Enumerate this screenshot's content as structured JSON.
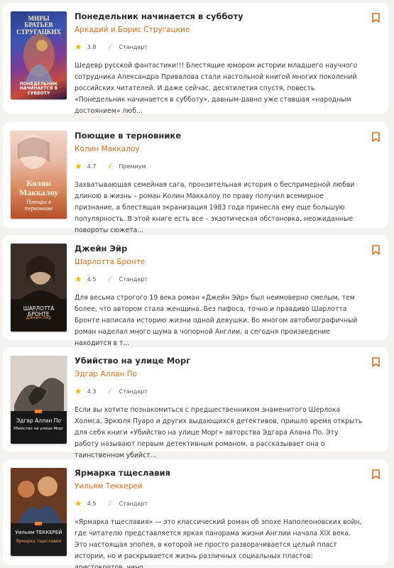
{
  "colors": {
    "accent": "#e06b17",
    "star": "#f2b705",
    "premium_icon": "#f2b705",
    "standard_icon": "#c7c7c7",
    "background": "#f4f2ef"
  },
  "books": [
    {
      "title": "Понедельник начинается в субботу",
      "author": "Аркадий и Борис Стругацкие",
      "rating": "3.8",
      "tier": "Стандарт",
      "description": "Шедевр русской фантастики!!! Блестящие юмором истории младшего научного сотрудника Александра Привалова стали настольной книгой многих поколений российских читателей. И даже сейчас, десятилетия спустя, повесть «Понедельник начинается в субботу», давным-давно уже ставшая «народным достоянием» люб...",
      "cover_top": "МИРЫ БРАТЬЕВ СТРУГАЦКИХ",
      "cover_bottom": "ПОНЕДЕЛЬНИК НАЧИНАЕТСЯ В СУББОТУ"
    },
    {
      "title": "Поющие в терновнике",
      "author": "Колин Маккалоу",
      "rating": "4.7",
      "tier": "Премиум",
      "description": "Захватывающая семейная сага, пронзительная история о беспримерной любви длиною в жизнь – роман Колин Маккалоу по праву получил всемирное признание, а блестящая экранизация 1983 года принесла ему еще большую популярность. В этой книге есть все – экзотическая обстановка, неожиданные повороты сюжета...",
      "cover_top": "Колин Маккалоу",
      "cover_bottom": "Поющие в терновнике"
    },
    {
      "title": "Джейн Эйр",
      "author": "Шарлотта Бронте",
      "rating": "4.5",
      "tier": "Стандарт",
      "description": "Для весьма строгого 19 века роман «Джейн Эйр» был неимоверно смелым, тем более, что автором стала женщина. Без пафоса, точно и правдиво Шарлотта Бронте написала историю жизни одной девушки. Во многом автобиографичный роман наделал много шума в чопорной Англии, а сегодня произведение находится в т...",
      "cover_top": "ШАРЛОТТА БРОНТЕ",
      "cover_bottom": "Джейн Эйр"
    },
    {
      "title": "Убийство на улице Морг",
      "author": "Эдгар Аллан По",
      "rating": "4.3",
      "tier": "Стандарт",
      "description": "Если вы хотите познакомиться с предшественником знаменитого Шерлока Холмса, Эркюля Пуаро и других выдающихся детективов, пришло время открыть для себя книги «Убийство на улице Морг» авторства Эдгара Алана По. Эту работу называют первым детективным романом, а рассказывает она о таинственном убийст...",
      "cover_top": "Эдгар Аллан По",
      "cover_bottom": "Убийство на улице Морг"
    },
    {
      "title": "Ярмарка тщеславия",
      "author": "Уильям Теккерей",
      "rating": "4.5",
      "tier": "Стандарт",
      "description": "«Ярмарка тщеславия» — это классический роман об эпохе Наполеоновских войн, где читателю представляется яркая панорама жизни Англии начала XIX века. Это настоящая эпопея, в которой не просто разворачивается целый пласт истории, но и раскрывается жизнь различных социальных пластов: аристократов, чино...",
      "cover_top": "Уильям ТЕККЕРЕЙ",
      "cover_bottom": "Ярмарка тщеславия"
    }
  ]
}
